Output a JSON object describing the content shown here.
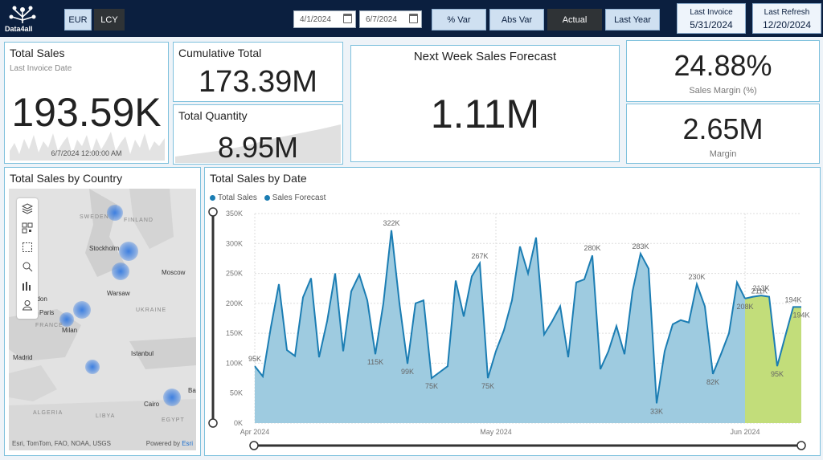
{
  "brand": {
    "name": "Data4all"
  },
  "currency": {
    "options": [
      "EUR",
      "LCY"
    ],
    "selected": "LCY"
  },
  "date_range": {
    "start": "4/1/2024",
    "end": "6/7/2024"
  },
  "measure_buttons": [
    "% Var",
    "Abs Var",
    "Actual",
    "Last Year"
  ],
  "measure_selected": "Actual",
  "last_invoice": {
    "label": "Last Invoice",
    "value": "5/31/2024"
  },
  "last_refresh": {
    "label": "Last Refresh",
    "value": "12/20/2024"
  },
  "kpi": {
    "total_sales": {
      "title": "Total Sales",
      "subtitle": "Last Invoice Date",
      "value": "193.59K",
      "date": "6/7/2024 12:00:00 AM"
    },
    "cumulative_total": {
      "title": "Cumulative Total",
      "value": "173.39M"
    },
    "total_quantity": {
      "title": "Total Quantity",
      "value": "8.95M"
    },
    "forecast": {
      "title": "Next Week Sales Forecast",
      "value": "1.11M"
    },
    "sales_margin": {
      "value": "24.88%",
      "label": "Sales Margin (%)"
    },
    "margin": {
      "value": "2.65M",
      "label": "Margin"
    }
  },
  "map": {
    "title": "Total Sales by Country",
    "cities": [
      "Stockholm",
      "Moscow",
      "Warsaw",
      "Paris",
      "Milan",
      "Madrid",
      "Istanbul",
      "Cairo",
      "ndon",
      "Ba"
    ],
    "countries": [
      "SWEDEN",
      "FINLAND",
      "UKRAINE",
      "FRANCE",
      "ALGERIA",
      "LIBYA",
      "EGYPT"
    ],
    "attribution": "Esri, TomTom, FAO, NOAA, USGS",
    "powered_by": "Powered by",
    "esri": "Esri"
  },
  "chart_data": {
    "type": "area",
    "title": "Total Sales by Date",
    "legend": [
      "Total Sales",
      "Sales Forecast"
    ],
    "y_ticks": [
      "0K",
      "50K",
      "100K",
      "150K",
      "200K",
      "250K",
      "300K",
      "350K"
    ],
    "ylim": [
      0,
      350000
    ],
    "x_ticks": [
      "Apr 2024",
      "May 2024",
      "Jun 2024"
    ],
    "x_tick_positions": [
      0,
      30,
      61
    ],
    "colors": {
      "actual": "#1b7db3",
      "actual_fill": "#9ecbe0",
      "forecast_fill": "#c2dd7a",
      "forecast_line": "#1b7db3"
    },
    "total_sales": [
      95,
      78,
      160,
      232,
      122,
      112,
      210,
      242,
      110,
      170,
      250,
      120,
      220,
      248,
      205,
      115,
      200,
      322,
      200,
      99,
      200,
      205,
      75,
      85,
      95,
      238,
      178,
      245,
      267,
      75,
      120,
      155,
      205,
      295,
      250,
      310,
      148,
      170,
      195,
      110,
      235,
      240,
      280,
      90,
      120,
      162,
      115,
      220,
      283,
      258,
      33,
      120,
      165,
      172,
      168,
      232,
      195,
      82,
      115,
      150,
      235,
      208
    ],
    "forecast": [
      208,
      211,
      213,
      211,
      95,
      145,
      194,
      194
    ],
    "labels": [
      {
        "i": 0,
        "text": "95K",
        "pos": "above",
        "series": "actual"
      },
      {
        "i": 17,
        "text": "322K",
        "pos": "above",
        "series": "actual"
      },
      {
        "i": 15,
        "text": "115K",
        "pos": "below",
        "series": "actual"
      },
      {
        "i": 19,
        "text": "99K",
        "pos": "below",
        "series": "actual"
      },
      {
        "i": 22,
        "text": "75K",
        "pos": "below",
        "series": "actual"
      },
      {
        "i": 28,
        "text": "267K",
        "pos": "above",
        "series": "actual"
      },
      {
        "i": 29,
        "text": "75K",
        "pos": "below",
        "series": "actual"
      },
      {
        "i": 42,
        "text": "280K",
        "pos": "above",
        "series": "actual"
      },
      {
        "i": 48,
        "text": "283K",
        "pos": "above",
        "series": "actual"
      },
      {
        "i": 50,
        "text": "33K",
        "pos": "below",
        "series": "actual"
      },
      {
        "i": 55,
        "text": "230K",
        "pos": "above",
        "series": "actual"
      },
      {
        "i": 57,
        "text": "82K",
        "pos": "below",
        "series": "actual"
      },
      {
        "i": 0,
        "text": "208K",
        "pos": "below",
        "series": "forecast"
      },
      {
        "i": 2,
        "text": "213K",
        "pos": "above",
        "series": "forecast"
      },
      {
        "i": 3,
        "text": "211K",
        "pos": "left",
        "series": "forecast"
      },
      {
        "i": 4,
        "text": "95K",
        "pos": "below",
        "series": "forecast"
      },
      {
        "i": 6,
        "text": "194K",
        "pos": "above",
        "series": "forecast"
      },
      {
        "i": 7,
        "text": "194K",
        "pos": "below",
        "series": "forecast"
      }
    ]
  }
}
